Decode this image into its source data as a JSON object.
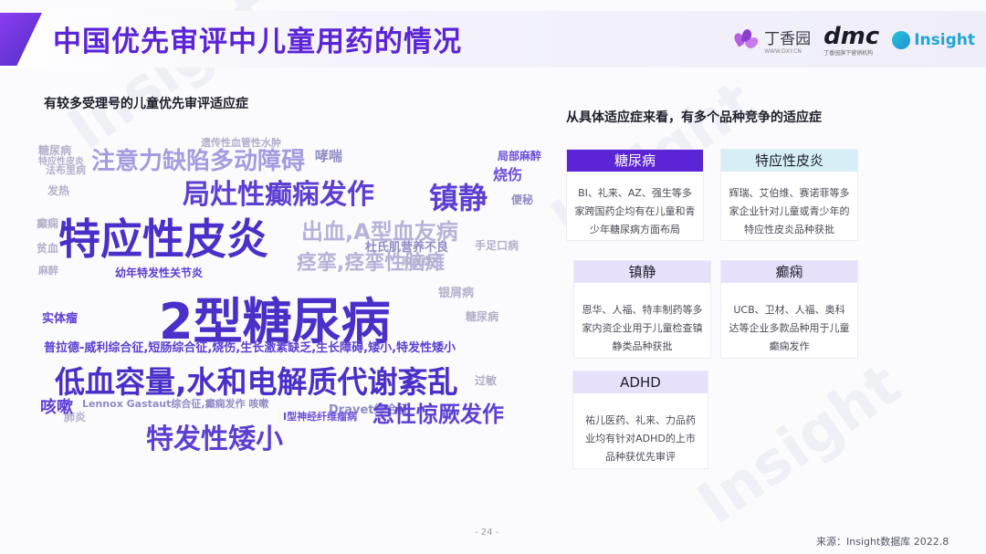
{
  "header": {
    "title": "中国优先审评中儿童用药的情况",
    "logos": {
      "dxy_name": "丁香园",
      "dxy_sub": "WWW.DXY.CN",
      "dmc_name": "dmc",
      "dmc_sub": "丁香园旗下营销机构",
      "insight_name": "Insight"
    }
  },
  "left": {
    "subtitle": "有较多受理号的儿童优先审评适应症",
    "cloud_words": [
      "2型糖尿病",
      "特应性皮炎",
      "低血容量,水和电解质代谢紊乱",
      "局灶性癫痫发作",
      "注意力缺陷多动障碍",
      "镇静",
      "特发性矮小",
      "急性惊厥发作",
      "普拉德-威利综合征,短肠综合征,烧伤,生长激素缺乏,生长障碍,矮小,特发性矮小",
      "出血,A型血友病",
      "痉挛,痉挛性脑瘫",
      "咳嗽",
      "Lennox Gastaut综合征,癫痫发作 咳嗽",
      "Dravet综合征",
      "幼年特发性关节炎",
      "实体瘤",
      "烧伤",
      "哮喘",
      "杜氏肌营养不良",
      "糖尿病",
      "手足口病",
      "遗传性血管性水肿",
      "I型神经纤维瘤病",
      "局部麻醉",
      "麻醉",
      "便秘",
      "法布里病",
      "特应性皮炎",
      "发热",
      "银屑病",
      "糖尿病",
      "癫痫",
      "过敏",
      "败血症",
      "贫血",
      "肺炎"
    ]
  },
  "right": {
    "subtitle": "从具体适应症来看，有多个品种竞争的适应症",
    "cards": [
      {
        "title": "糖尿病",
        "text": "BI、礼来、AZ、强生等多家跨国药企均有在儿童和青少年糖尿病方面布局"
      },
      {
        "title": "特应性皮炎",
        "text": "辉瑞、艾伯维、赛诺菲等多家企业针对儿童或青少年的特应性皮炎品种获批"
      },
      {
        "title": "镇静",
        "text": "恩华、人福、特丰制药等多家内资企业用于儿童检查镇静类品种获批"
      },
      {
        "title": "癫痫",
        "text": "UCB、卫材、人福、奥科达等企业多款品种用于儿童癫痫发作"
      },
      {
        "title": "ADHD",
        "text": "祐儿医药、礼来、力品药业均有针对ADHD的上市品种获优先审评"
      }
    ]
  },
  "footer": {
    "page": "- 24 -",
    "source": "来源：Insight数据库 2022.8"
  },
  "watermark": "Insight",
  "colors": {
    "title": "#5b24d6",
    "cloud_primary": "#5d3fd3",
    "cloud_muted": "#b3b0c9",
    "card_head_dark": "#5b24d6",
    "card_head_teal": "#d6eef5",
    "card_head_lavender": "#e7e0fb"
  }
}
